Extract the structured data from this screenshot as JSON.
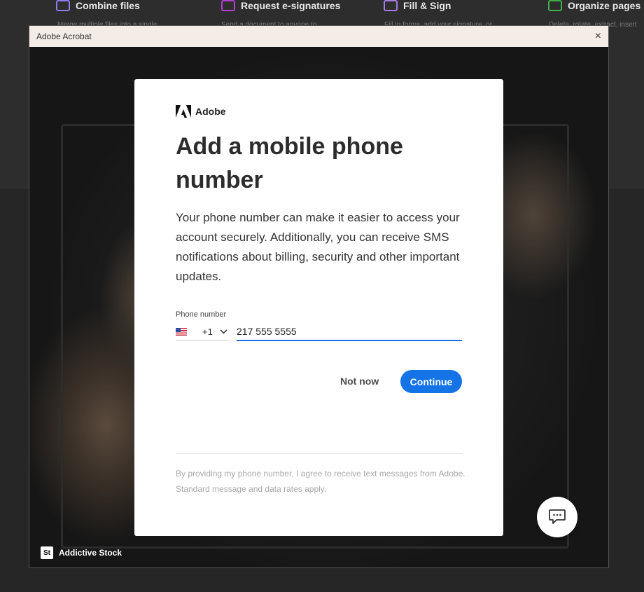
{
  "background_toolbar": {
    "tools": [
      {
        "label": "Combine files",
        "icon": "combine-files-icon",
        "color": "#8e7cf0",
        "desc": "Merge multiple files into a single"
      },
      {
        "label": "Request e-signatures",
        "icon": "request-esign-icon",
        "color": "#b43fd6",
        "desc": "Send a document to anyone to"
      },
      {
        "label": "Fill & Sign",
        "icon": "fill-sign-icon",
        "color": "#a67ae8",
        "desc": "Fill in forms, add your signature, or"
      },
      {
        "label": "Organize pages",
        "icon": "organize-pages-icon",
        "color": "#3fb24b",
        "desc": "Delete, rotate, extract, insert"
      }
    ]
  },
  "window": {
    "title": "Adobe Acrobat",
    "close_glyph": "×",
    "credit_badge": "St",
    "credit_text": "Addictive Stock"
  },
  "dialog": {
    "brand": "Adobe",
    "heading": "Add a mobile phone number",
    "description": "Your phone number can make it easier to access your account securely. Additionally, you can receive SMS notifications about billing, security and other important updates.",
    "phone_label": "Phone number",
    "country_code": "+1",
    "country_flag": "us-flag-icon",
    "phone_value": "217 555 5555",
    "not_now_label": "Not now",
    "continue_label": "Continue",
    "legal_text": "By providing my phone number, I agree to receive text messages from Adobe. Standard message and data rates apply."
  },
  "colors": {
    "accent": "#1473e6",
    "titlebar": "#f4ece6"
  }
}
